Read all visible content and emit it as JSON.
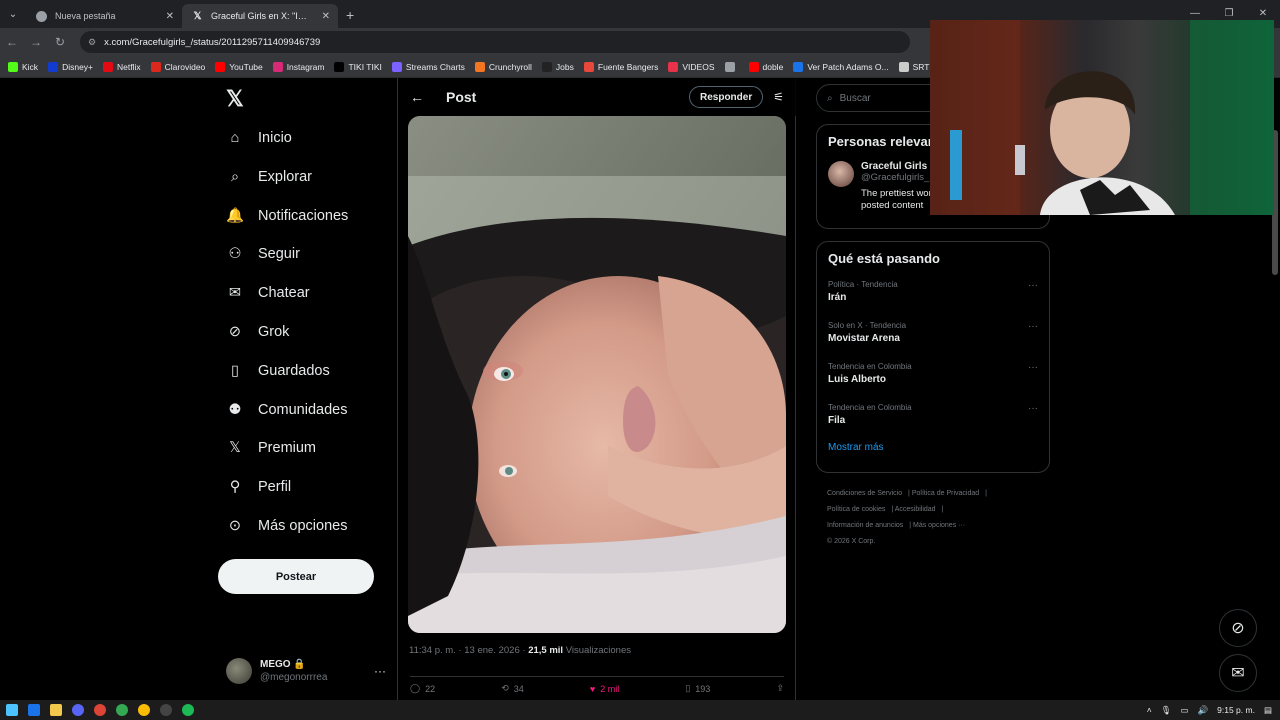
{
  "browser": {
    "tabs": [
      {
        "title": "Nueva pestaña",
        "active": false
      },
      {
        "title": "Graceful Girls en X: \"Imagine w",
        "active": true
      }
    ],
    "url": "x.com/Gracefulgirls_/status/2011295711409946739",
    "bookmarks": [
      {
        "label": "Kick",
        "color": "#53fc18"
      },
      {
        "label": "Disney+",
        "color": "#113ccf"
      },
      {
        "label": "Netflix",
        "color": "#e50914"
      },
      {
        "label": "Clarovideo",
        "color": "#da291c"
      },
      {
        "label": "YouTube",
        "color": "#ff0000"
      },
      {
        "label": "Instagram",
        "color": "#d62976"
      },
      {
        "label": "TIKI TIKI",
        "color": "#000000"
      },
      {
        "label": "Streams Charts",
        "color": "#7b61ff"
      },
      {
        "label": "Crunchyroll",
        "color": "#f47521"
      },
      {
        "label": "Jobs",
        "color": "#222222"
      },
      {
        "label": "Fuente Bangers",
        "color": "#e8473c"
      },
      {
        "label": "VIDEOS",
        "color": "#e8324a"
      },
      {
        "label": "",
        "color": "#9aa0a6"
      },
      {
        "label": "doble",
        "color": "#ff0000"
      },
      {
        "label": "Ver Patch Adams O...",
        "color": "#1a73e8"
      },
      {
        "label": "SRT Mini Se",
        "color": "#cccccc"
      }
    ]
  },
  "nav": {
    "items": [
      {
        "label": "Inicio",
        "icon": "home-icon"
      },
      {
        "label": "Explorar",
        "icon": "search-icon"
      },
      {
        "label": "Notificaciones",
        "icon": "bell-icon"
      },
      {
        "label": "Seguir",
        "icon": "person-add-icon"
      },
      {
        "label": "Chatear",
        "icon": "mail-icon"
      },
      {
        "label": "Grok",
        "icon": "grok-icon"
      },
      {
        "label": "Guardados",
        "icon": "bookmark-icon"
      },
      {
        "label": "Comunidades",
        "icon": "communities-icon"
      },
      {
        "label": "Premium",
        "icon": "x-icon"
      },
      {
        "label": "Perfil",
        "icon": "person-icon"
      },
      {
        "label": "Más opciones",
        "icon": "more-circle-icon"
      }
    ],
    "post_button": "Postear",
    "account": {
      "name": "MEGO",
      "handle": "@megonorrrea"
    }
  },
  "main": {
    "title": "Post",
    "reply_button": "Responder",
    "meta_time": "11:34 p. m. · 13 ene. 2026 ·",
    "meta_views": "21,5 mil",
    "meta_views_label": "Visualizaciones",
    "actions": {
      "replies": "22",
      "reposts": "34",
      "likes": "2 mil",
      "bookmarks": "193"
    }
  },
  "right": {
    "search_placeholder": "Buscar",
    "relevant": {
      "title": "Personas relevantes",
      "name": "Graceful Girls",
      "handle": "@Gracefulgirls_",
      "bio": "The prettiest women. I own none of the posted content"
    },
    "trends_title": "Qué está pasando",
    "trends": [
      {
        "context": "Política · Tendencia",
        "name": "Irán"
      },
      {
        "context": "Solo en X · Tendencia",
        "name": "Movistar Arena"
      },
      {
        "context": "Tendencia en Colombia",
        "name": "Luis Alberto"
      },
      {
        "context": "Tendencia en Colombia",
        "name": "Fila"
      }
    ],
    "show_more": "Mostrar más",
    "footer": {
      "links1": [
        "Condiciones de Servicio",
        "Política de Privacidad"
      ],
      "links2": [
        "Política de cookies",
        "Accesibilidad"
      ],
      "links3": [
        "Información de anuncios",
        "Más opciones ···"
      ],
      "copyright": "© 2026 X Corp."
    }
  },
  "taskbar": {
    "time": "9:15 p. m."
  }
}
